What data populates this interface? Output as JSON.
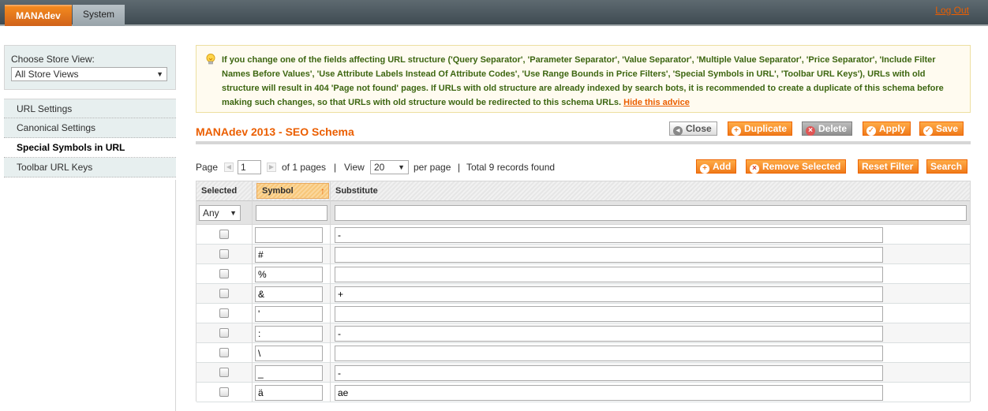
{
  "nav": {
    "active_tab": "MANAdev",
    "system_tab": "System",
    "logout": "Log Out"
  },
  "sidebar": {
    "store_label": "Choose Store View:",
    "store_value": "All Store Views",
    "items": [
      {
        "label": "URL Settings"
      },
      {
        "label": "Canonical Settings"
      },
      {
        "label": "Special Symbols in URL"
      },
      {
        "label": "Toolbar URL Keys"
      }
    ]
  },
  "notice": {
    "text": "If you change one of the fields affecting URL structure ('Query Separator', 'Parameter Separator', 'Value Separator', 'Multiple Value Separator', 'Price Separator', 'Include Filter Names Before Values', 'Use Attribute Labels Instead Of Attribute Codes', 'Use Range Bounds in Price Filters', 'Special Symbols in URL', 'Toolbar URL Keys'), URLs with old structure will result in 404 'Page not found' pages. If URLs with old structure are already indexed by search bots, it is recommended to create a duplicate of this schema before making such changes, so that URLs with old structure would be redirected to this schema URLs.",
    "link": "Hide this advice"
  },
  "header": {
    "title": "MANAdev 2013 - SEO Schema",
    "buttons": {
      "close": "Close",
      "duplicate": "Duplicate",
      "delete": "Delete",
      "apply": "Apply",
      "save": "Save"
    }
  },
  "pager": {
    "page_label": "Page",
    "page_value": "1",
    "of_pages": "of 1 pages",
    "sep1": "|",
    "view_label": "View",
    "per_page": "20",
    "per_page_label": "per page",
    "sep2": "|",
    "total": "Total 9 records found"
  },
  "grid_buttons": {
    "add": "Add",
    "remove": "Remove Selected",
    "reset": "Reset Filter",
    "search": "Search"
  },
  "grid": {
    "columns": [
      "Selected",
      "Symbol",
      "Substitute"
    ],
    "filter_any": "Any",
    "rows": [
      {
        "symbol": "",
        "substitute": "-"
      },
      {
        "symbol": "#",
        "substitute": ""
      },
      {
        "symbol": "%",
        "substitute": ""
      },
      {
        "symbol": "&",
        "substitute": "+"
      },
      {
        "symbol": "'",
        "substitute": ""
      },
      {
        "symbol": ":",
        "substitute": "-"
      },
      {
        "symbol": "\\",
        "substitute": ""
      },
      {
        "symbol": "_",
        "substitute": "-"
      },
      {
        "symbol": "ä",
        "substitute": "ae"
      }
    ]
  }
}
